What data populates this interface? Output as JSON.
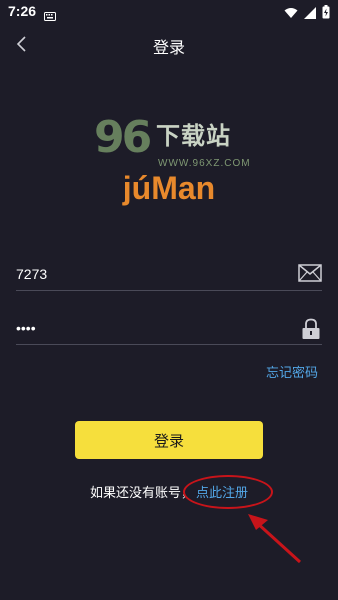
{
  "status_bar": {
    "time": "7:26",
    "left_icon": "keyboard-icon",
    "right_icons": [
      "wifi-icon",
      "cellular-signal-icon",
      "battery-charging-icon"
    ]
  },
  "header": {
    "title": "登录",
    "back_icon": "chevron-left-icon"
  },
  "watermark": {
    "digits": "96",
    "text": "下载站",
    "url": "WWW.96XZ.COM"
  },
  "logo": {
    "text": "júMan"
  },
  "form": {
    "account": {
      "value": "7273",
      "icon": "mail-icon"
    },
    "password": {
      "value": "••••",
      "icon": "lock-icon"
    },
    "forgot_label": "忘记密码",
    "login_label": "登录",
    "register_prompt": "如果还没有账号，",
    "register_link": "点此注册"
  },
  "colors": {
    "background": "#1d1c28",
    "login_button": "#f6df3c",
    "link": "#53a7e8",
    "logo": "#e8892c",
    "annotation": "#c8141a"
  }
}
